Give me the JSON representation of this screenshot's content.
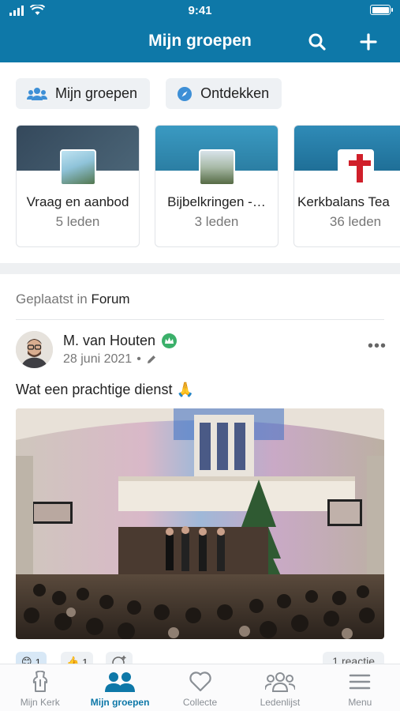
{
  "status": {
    "time": "9:41"
  },
  "header": {
    "title": "Mijn groepen"
  },
  "tabs": [
    {
      "label": "Mijn groepen",
      "icon": "users-icon"
    },
    {
      "label": "Ontdekken",
      "icon": "compass-icon"
    }
  ],
  "groups": [
    {
      "name": "Vraag en aanbod",
      "members": "5 leden"
    },
    {
      "name": "Bijbelkringen -…",
      "members": "3 leden"
    },
    {
      "name": "Kerkbalans Tea",
      "members": "36 leden"
    }
  ],
  "post": {
    "posted_prefix": "Geplaatst in",
    "posted_location": "Forum",
    "author": "M. van Houten",
    "date": "28 juni 2021",
    "date_separator": "•",
    "text": "Wat een prachtige dienst 🙏",
    "reactions": [
      {
        "emoji": "😊",
        "count": "1"
      },
      {
        "emoji": "👍",
        "count": "1"
      }
    ],
    "reply_count": "1 reactie"
  },
  "bottom_nav": [
    {
      "label": "Mijn Kerk",
      "icon": "church-icon",
      "active": false
    },
    {
      "label": "Mijn groepen",
      "icon": "groups-icon",
      "active": true
    },
    {
      "label": "Collecte",
      "icon": "heart-icon",
      "active": false
    },
    {
      "label": "Ledenlijst",
      "icon": "members-icon",
      "active": false
    },
    {
      "label": "Menu",
      "icon": "hamburger-icon",
      "active": false
    }
  ],
  "colors": {
    "primary": "#0e78a8",
    "verified": "#3bb06a",
    "muted": "#777777"
  }
}
